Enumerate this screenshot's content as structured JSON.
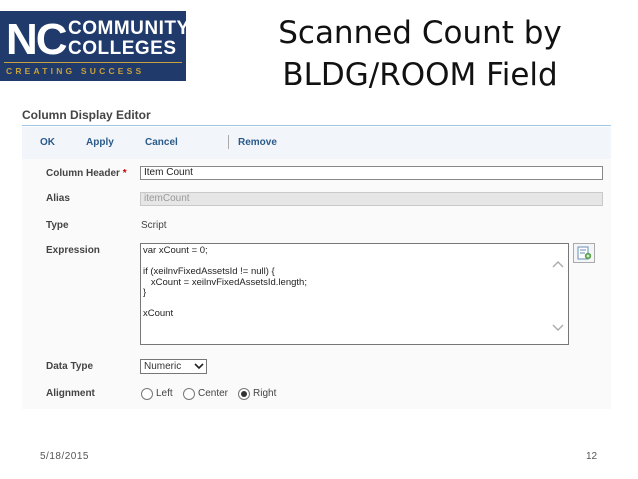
{
  "logo": {
    "mark": "NC",
    "line1": "COMMUNITY",
    "line2": "COLLEGES",
    "tagline": "CREATING SUCCESS"
  },
  "slide": {
    "title_line1": "Scanned Count by",
    "title_line2": "BLDG/ROOM Field",
    "date": "5/18/2015",
    "page": "12"
  },
  "editor": {
    "title": "Column Display Editor",
    "toolbar": {
      "ok": "OK",
      "apply": "Apply",
      "cancel": "Cancel",
      "remove": "Remove"
    },
    "fields": {
      "column_header_label": "Column Header",
      "required_mark": "*",
      "column_header_value": "Item Count",
      "alias_label": "Alias",
      "alias_value": "itemCount",
      "type_label": "Type",
      "type_value": "Script",
      "expression_label": "Expression",
      "expression_value": "var xCount = 0;\n\nif (xeilnvFixedAssetsId != null) {\n   xCount = xeilnvFixedAssetsId.length;\n}\n\nxCount",
      "data_type_label": "Data Type",
      "data_type_value": "Numeric",
      "alignment_label": "Alignment",
      "alignment_options": [
        "Left",
        "Center",
        "Right"
      ],
      "alignment_selected": "Right"
    }
  },
  "colors": {
    "logo_bg": "#1f3a6b",
    "logo_accent": "#c8a23a",
    "toolbar_text": "#2a5a8a",
    "rule": "#9fc6e6"
  }
}
